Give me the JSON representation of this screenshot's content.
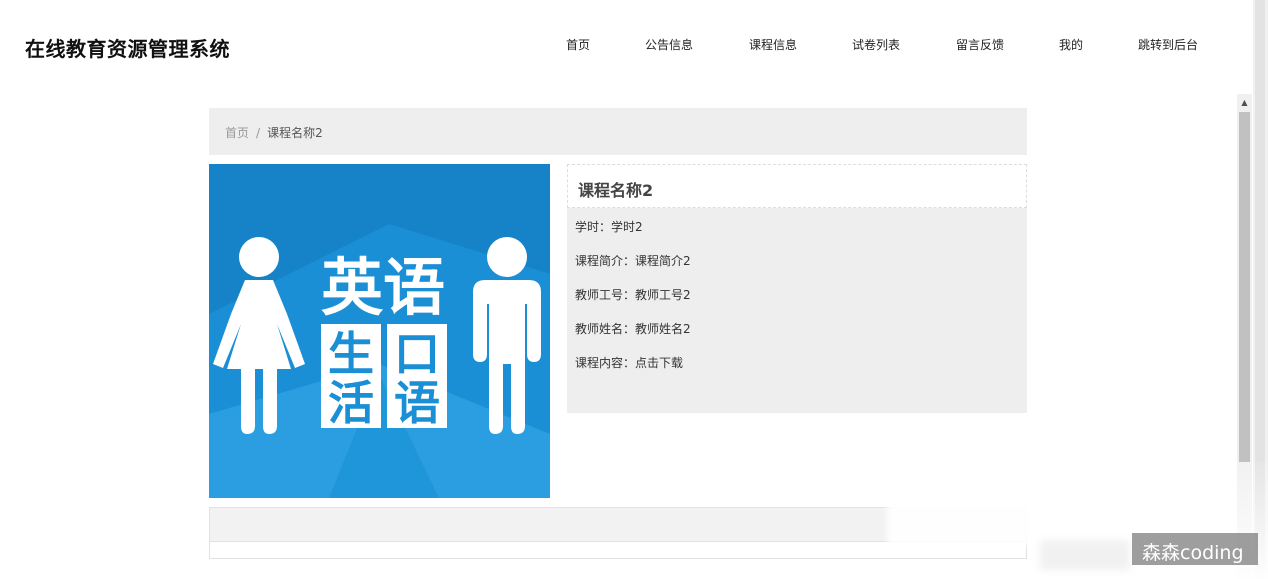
{
  "header": {
    "site_title": "在线教育资源管理系统",
    "nav": [
      "首页",
      "公告信息",
      "课程信息",
      "试卷列表",
      "留言反馈",
      "我的",
      "跳转到后台"
    ]
  },
  "breadcrumb": {
    "home": "首页",
    "separator": "/",
    "current": "课程名称2"
  },
  "course_image": {
    "alt": "英语生活口语",
    "title_chars": "英语",
    "sub_chars": [
      "生",
      "口",
      "活",
      "语"
    ],
    "background_color": "#1a8fd6"
  },
  "detail": {
    "title": "课程名称2",
    "rows": [
      {
        "label": "学时：",
        "value": "学时2"
      },
      {
        "label": "课程简介：",
        "value": "课程简介2"
      },
      {
        "label": "教师工号：",
        "value": "教师工号2"
      },
      {
        "label": "教师姓名：",
        "value": "教师姓名2"
      },
      {
        "label": "课程内容：",
        "value": "点击下载"
      }
    ]
  },
  "watermark": "森森coding",
  "colors": {
    "panel_bg": "#eeeeee",
    "image_blue": "#1a8fd6"
  }
}
